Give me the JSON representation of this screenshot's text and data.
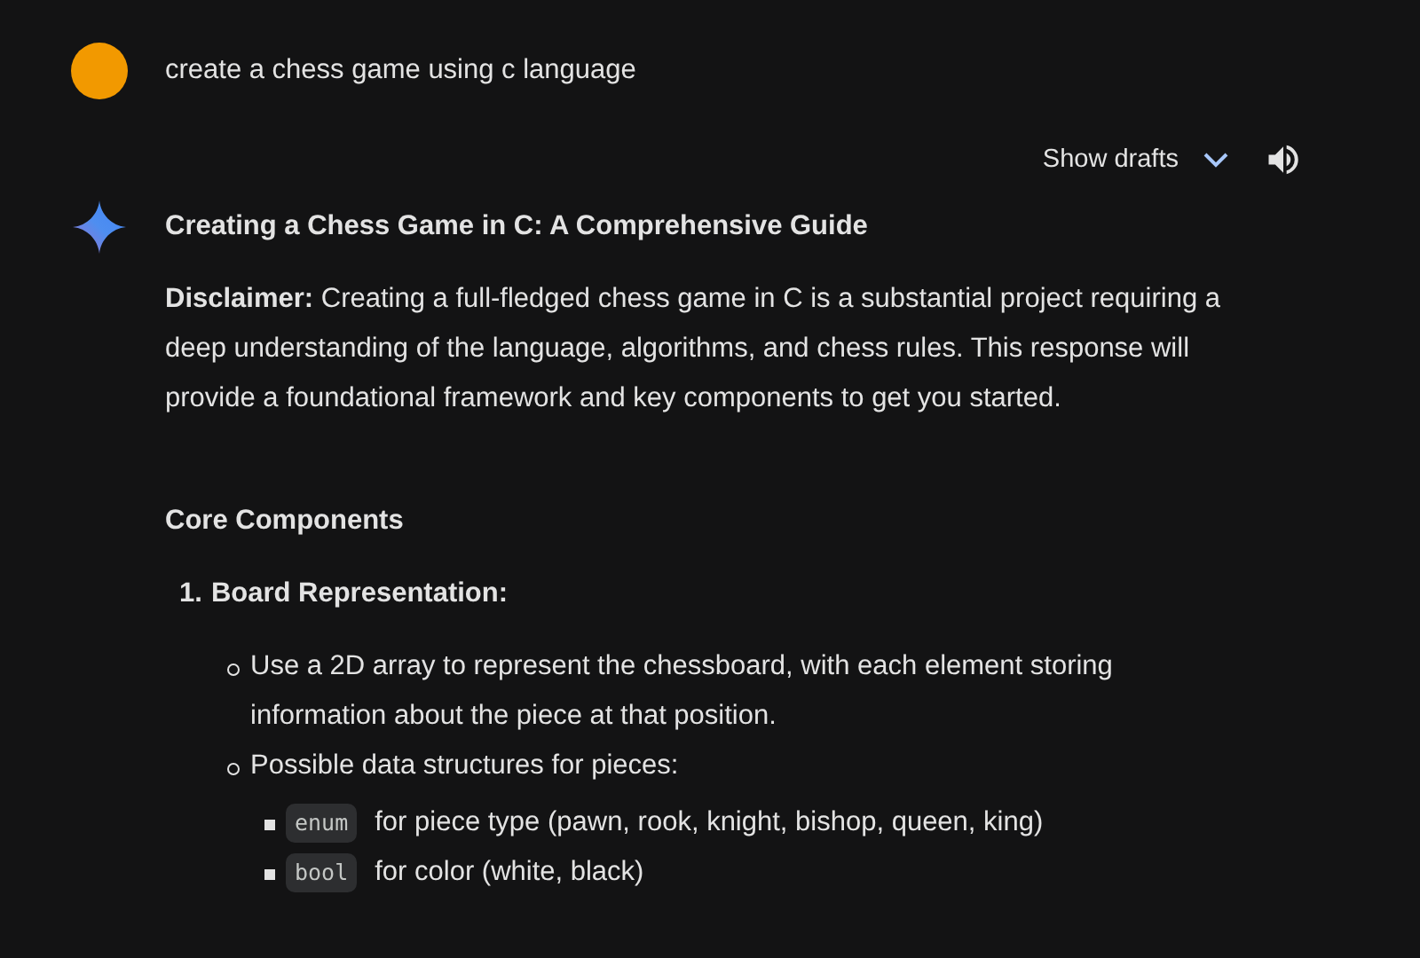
{
  "prompt": {
    "text": "create a chess game using c language"
  },
  "response": {
    "drafts_label": "Show drafts",
    "title": "Creating a Chess Game in C: A Comprehensive Guide",
    "disclaimer": "**Disclaimer:** Creating a full-fledged chess game in C is a substantial project requiring a deep understanding of the language, algorithms, and chess rules. This response will provide a foundational framework and key components to get you started.",
    "section_heading": "Core Components",
    "list": [
      {
        "number": "1.",
        "label": "Board Representation:",
        "items": [
          {
            "text": "Use a 2D array to represent the chessboard, with each element storing information about the piece at that position."
          },
          {
            "text": "Possible data structures for pieces:",
            "children": [
              {
                "code": "enum",
                "text": "for piece type (pawn, rook, knight, bishop, queen, king)"
              },
              {
                "code": "bool",
                "text": "for color (white, black)"
              }
            ]
          }
        ]
      }
    ]
  }
}
